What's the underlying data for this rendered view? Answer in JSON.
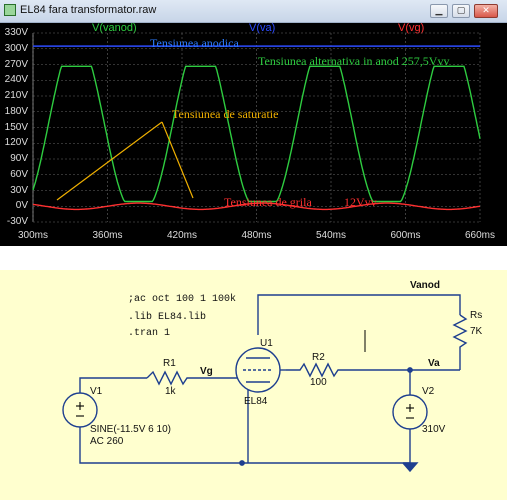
{
  "window": {
    "title": "EL84 fara transformator.raw"
  },
  "trace_labels": [
    {
      "text": "V(vanod)",
      "color": "#2ecc40"
    },
    {
      "text": "V(va)",
      "color": "#2c4bff"
    },
    {
      "text": "V(vg)",
      "color": "#ff3030"
    }
  ],
  "annotations": {
    "anodic": "Tensiunea anodica",
    "ac_anode": "Tensiunea alternativa in anod 257,5Vvv",
    "saturation": "Tensiunea de saturatie",
    "grid": "Tensiunea de grila",
    "grid_value": "12Vvv"
  },
  "chart_data": {
    "type": "line",
    "x_unit": "ms",
    "xlim": [
      300,
      660
    ],
    "ylim": [
      -30,
      330
    ],
    "x_ticks": [
      "300ms",
      "360ms",
      "420ms",
      "480ms",
      "540ms",
      "600ms",
      "660ms"
    ],
    "y_ticks": [
      "330V",
      "300V",
      "270V",
      "240V",
      "210V",
      "180V",
      "150V",
      "120V",
      "90V",
      "60V",
      "30V",
      "0V",
      "-30V"
    ],
    "series": [
      {
        "name": "V(va)",
        "color": "#2c4bff",
        "type": "constant",
        "value": 305
      },
      {
        "name": "V(vanod)",
        "color": "#2ecc40",
        "type": "periodic",
        "min": 9,
        "max": 266.5,
        "period_ms": 100,
        "peaks_ms": [
          335,
          435,
          535,
          635
        ]
      },
      {
        "name": "V(vg)",
        "color": "#ff3030",
        "type": "periodic",
        "min": -6,
        "max": 6,
        "period_ms": 100,
        "peaks_ms": [
          385,
          485,
          585
        ]
      }
    ]
  },
  "schematic": {
    "directives": [
      ";ac oct 100 1 100k",
      ".lib EL84.lib",
      ".tran 1"
    ],
    "labels": {
      "vanod": "Vanod",
      "va": "Va",
      "vg": "Vg",
      "u1": "U1",
      "u1_model": "EL84",
      "r1": "R1",
      "r1_value": "1k",
      "r2": "R2",
      "r2_value": "100",
      "rs": "Rs",
      "rs_value": "7K",
      "v1": "V1",
      "v1_spec": "SINE(-11.5V 6 10)",
      "v1_ac": "AC 260",
      "v2": "V2",
      "v2_value": "310V"
    }
  }
}
